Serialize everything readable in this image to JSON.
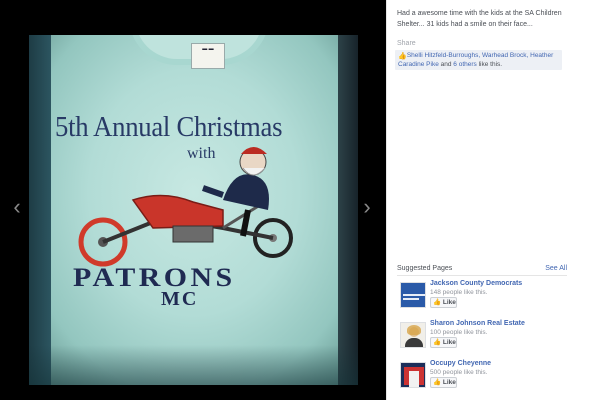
{
  "photo": {
    "shirt_text": {
      "line1": "5th Annual Christmas",
      "line2": "with",
      "line3": "PATRONS",
      "line4": "MC"
    }
  },
  "nav": {
    "prev_icon": "chevron-left-icon",
    "next_icon": "chevron-right-icon",
    "prev_glyph": "‹",
    "next_glyph": "›"
  },
  "post": {
    "caption": "Had a awesome time with the kids at the SA Children Shelter... 31 kids had a smile on their face...",
    "share_label": "Share",
    "likes": {
      "names": "Shelli Hitzfeld-Burroughs, Warhead Brock, Heather Caradine Pike",
      "and": " and ",
      "others": "6 others",
      "suffix": " like this."
    }
  },
  "suggested": {
    "title": "Suggested Pages",
    "see_all": "See All",
    "pages": [
      {
        "name": "Jackson County Democrats",
        "count": "148 people like this.",
        "like_label": "Like"
      },
      {
        "name": "Sharon Johnson Real Estate",
        "count": "100 people like this.",
        "like_label": "Like"
      },
      {
        "name": "Occupy Cheyenne",
        "count": "500 people like this.",
        "like_label": "Like"
      }
    ]
  },
  "colors": {
    "link": "#4267b2",
    "stage": "#000000",
    "shirt": "#b2dcd6",
    "ink": "#283a66"
  }
}
